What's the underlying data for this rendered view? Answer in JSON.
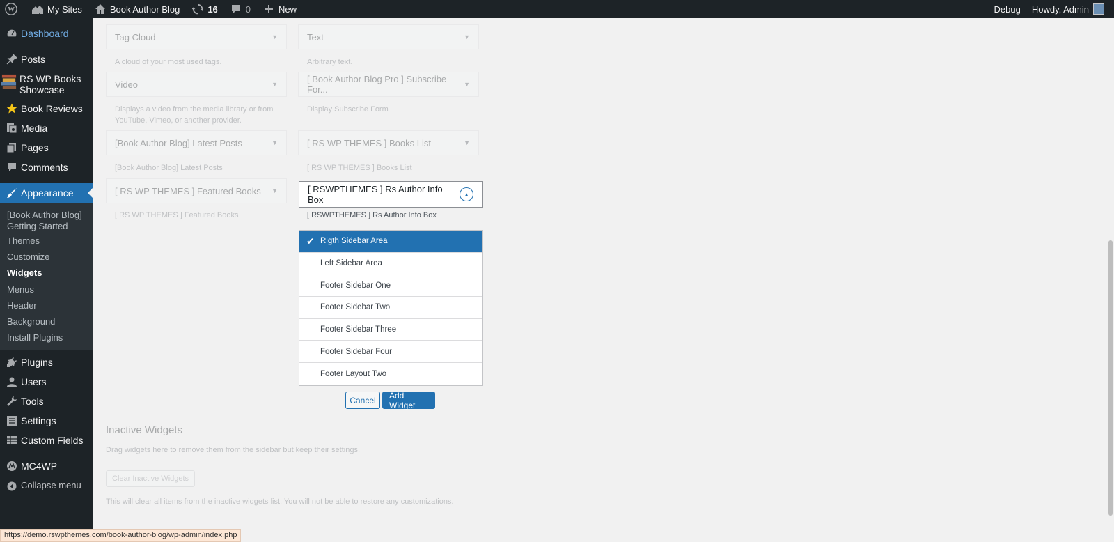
{
  "adminbar": {
    "my_sites": "My Sites",
    "site_name": "Book Author Blog",
    "updates_count": "16",
    "comments_count": "0",
    "new_label": "New",
    "debug_label": "Debug",
    "howdy": "Howdy, Admin"
  },
  "menu": {
    "dashboard": "Dashboard",
    "posts": "Posts",
    "rs_books": "RS WP Books Showcase",
    "book_reviews": "Book Reviews",
    "media": "Media",
    "pages": "Pages",
    "comments": "Comments",
    "appearance": "Appearance",
    "submenu": [
      "[Book Author Blog] Getting Started",
      "Themes",
      "Customize",
      "Widgets",
      "Menus",
      "Header",
      "Background",
      "Install Plugins"
    ],
    "plugins": "Plugins",
    "users": "Users",
    "tools": "Tools",
    "settings": "Settings",
    "custom_fields": "Custom Fields",
    "mc4wp": "MC4WP",
    "collapse": "Collapse menu"
  },
  "widgets": [
    {
      "title": "Tag Cloud",
      "desc": "A cloud of your most used tags."
    },
    {
      "title": "Text",
      "desc": "Arbitrary text."
    },
    {
      "title": "Video",
      "desc": "Displays a video from the media library or from YouTube, Vimeo, or another provider."
    },
    {
      "title": "[ Book Author Blog Pro ] Subscribe For...",
      "desc": "Display Subscribe Form"
    },
    {
      "title": "[Book Author Blog] Latest Posts",
      "desc": "[Book Author Blog] Latest Posts"
    },
    {
      "title": "[ RS WP THEMES ] Books List",
      "desc": "[ RS WP THEMES ] Books List"
    },
    {
      "title": "[ RS WP THEMES ] Featured Books",
      "desc": "[ RS WP THEMES ] Featured Books"
    }
  ],
  "active_widget": {
    "title": "[ RSWPTHEMES ] Rs Author Info Box",
    "desc": "[ RSWPTHEMES ] Rs Author Info Box"
  },
  "sidebar_areas": [
    "Rigth Sidebar Area",
    "Left Sidebar Area",
    "Footer Sidebar One",
    "Footer Sidebar Two",
    "Footer Sidebar Three",
    "Footer Sidebar Four",
    "Footer Layout Two"
  ],
  "selected_area_index": 0,
  "buttons": {
    "cancel": "Cancel",
    "add_widget": "Add Widget"
  },
  "inactive": {
    "title": "Inactive Widgets",
    "desc": "Drag widgets here to remove them from the sidebar but keep their settings.",
    "clear_button": "Clear Inactive Widgets",
    "clear_desc": "This will clear all items from the inactive widgets list. You will not be able to restore any customizations."
  },
  "status_url": "https://demo.rswpthemes.com/book-author-blog/wp-admin/index.php",
  "colors": {
    "admin_dark": "#1d2327",
    "accent_blue": "#2271b1",
    "submenu_bg": "#2c3338",
    "link_blue": "#72aee6"
  }
}
